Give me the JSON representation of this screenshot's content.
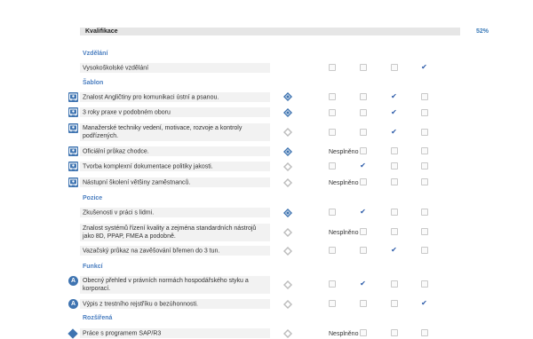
{
  "header": {
    "label": "Kvalifikace",
    "percent": "52%"
  },
  "sections": {
    "vzdelani": "Vzdělání",
    "sablon": "Šablon",
    "pozice": "Pozice",
    "funkci": "Funkcí",
    "rozsirena": "Rozšířená"
  },
  "rows": [
    {
      "text": "Vysokoškolské vzdělání",
      "status": "",
      "checked_col": 4
    },
    {
      "text": "Znalost Angličtiny pro komunikaci ústní a psanou.",
      "status": "",
      "checked_col": 3
    },
    {
      "text": "3 roky praxe v podobném oboru",
      "status": "",
      "checked_col": 3
    },
    {
      "text": "Manažerské techniky vedení, motivace, rozvoje a kontroly podřízených.",
      "status": "",
      "checked_col": 3
    },
    {
      "text": "Oficiální průkaz chodce.",
      "status": "Nesplněno",
      "checked_col": 0
    },
    {
      "text": "Tvorba komplexní dokumentace politiky jakosti.",
      "status": "",
      "checked_col": 2
    },
    {
      "text": "Nástupní školení většiny zaměstnanců.",
      "status": "Nesplněno",
      "checked_col": 0
    },
    {
      "text": "Zkušenosti v práci s lidmi.",
      "status": "",
      "checked_col": 2
    },
    {
      "text": "Znalost systémů řízení kvality a zejména standardních nástrojů jako 8D, PPAP, FMEA a podobně.",
      "status": "Nesplněno",
      "checked_col": 0
    },
    {
      "text": "Vazačský průkaz na zavěšování břemen do 3 tun.",
      "status": "",
      "checked_col": 3
    },
    {
      "text": "Obecný přehled v právních normách hospodářského styku a korporací.",
      "status": "",
      "checked_col": 2
    },
    {
      "text": "Výpis z trestního rejstříku o bezúhonnosti.",
      "status": "",
      "checked_col": 4
    },
    {
      "text": "Práce s programem SAP/R3",
      "status": "Nesplněno",
      "checked_col": 0
    }
  ],
  "colors": {
    "accent": "#3f74b1",
    "section": "#4a7ec0",
    "check": "#2a5aa8",
    "row_bg": "#f2f2f2"
  },
  "icons": {
    "template": "person-card-icon",
    "function": "function-a-icon",
    "extended": "diamond-icon",
    "level_filled": "level-diamond-filled-icon",
    "level_empty": "level-diamond-empty-icon",
    "checkmark": "checkmark-icon"
  }
}
